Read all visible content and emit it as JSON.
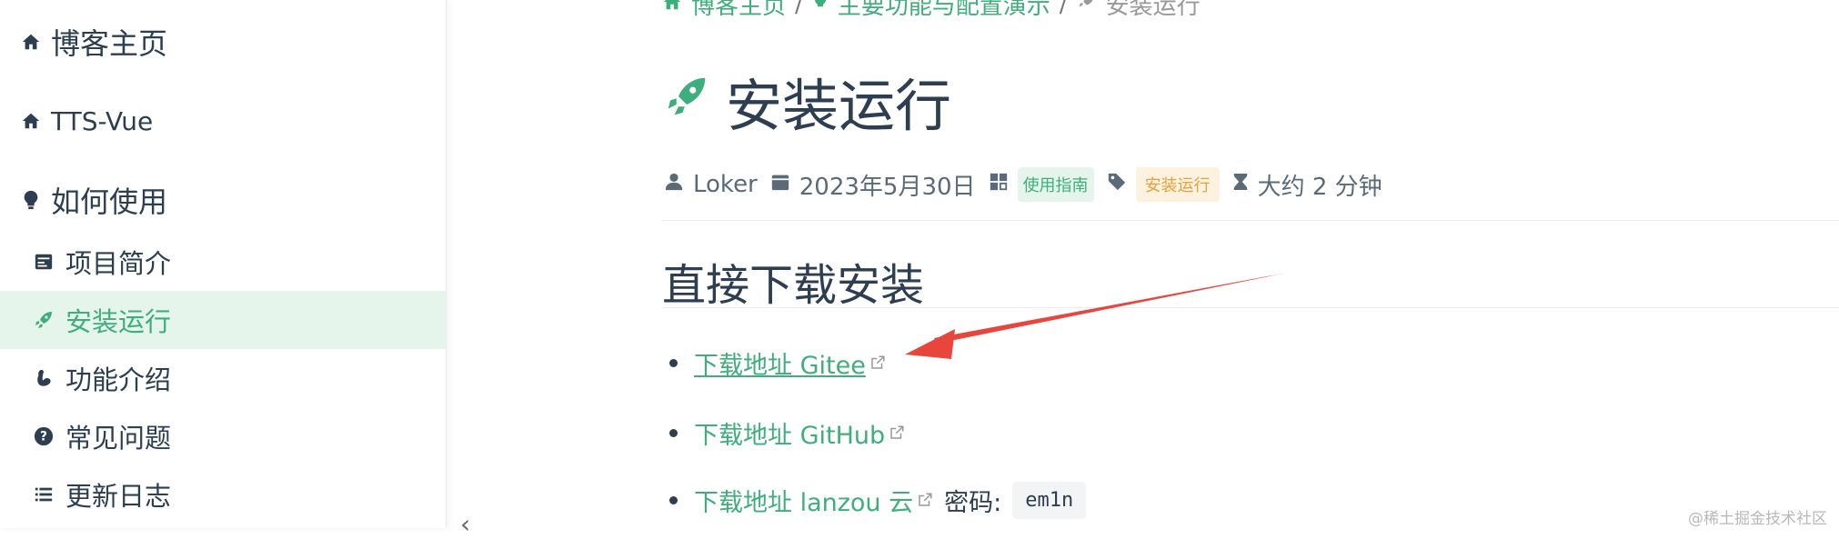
{
  "sidebar": {
    "top_items": [
      {
        "label": "博客主页",
        "icon": "home-icon"
      },
      {
        "label": "TTS-Vue",
        "icon": "home-icon"
      },
      {
        "label": "如何使用",
        "icon": "lightbulb-icon"
      }
    ],
    "items": [
      {
        "label": "项目简介",
        "icon": "article-icon",
        "active": false
      },
      {
        "label": "安装运行",
        "icon": "rocket-icon",
        "active": true
      },
      {
        "label": "功能介绍",
        "icon": "bicep-icon",
        "active": false
      },
      {
        "label": "常见问题",
        "icon": "question-circle-icon",
        "active": false
      },
      {
        "label": "更新日志",
        "icon": "list-icon",
        "active": false
      }
    ]
  },
  "breadcrumb": [
    "博客主页",
    "主要功能与配置演示",
    "安装运行"
  ],
  "page": {
    "title": "安装运行",
    "meta": {
      "author": "Loker",
      "date": "2023年5月30日",
      "category": "使用指南",
      "tag": "安装运行",
      "reading_time": "大约 2 分钟"
    },
    "section_heading": "直接下载安装",
    "links": [
      {
        "label": "下载地址 Gitee"
      },
      {
        "label": "下载地址 GitHub"
      },
      {
        "label": "下载地址 lanzou 云",
        "suffix": "密码:",
        "code": "em1n"
      }
    ]
  },
  "watermark": "@稀土掘金技术社区",
  "colors": {
    "accent": "#3eaf7c",
    "text": "#2c3e50",
    "annotation_arrow": "#e8453c",
    "tag_orange": "#e6a23c"
  }
}
